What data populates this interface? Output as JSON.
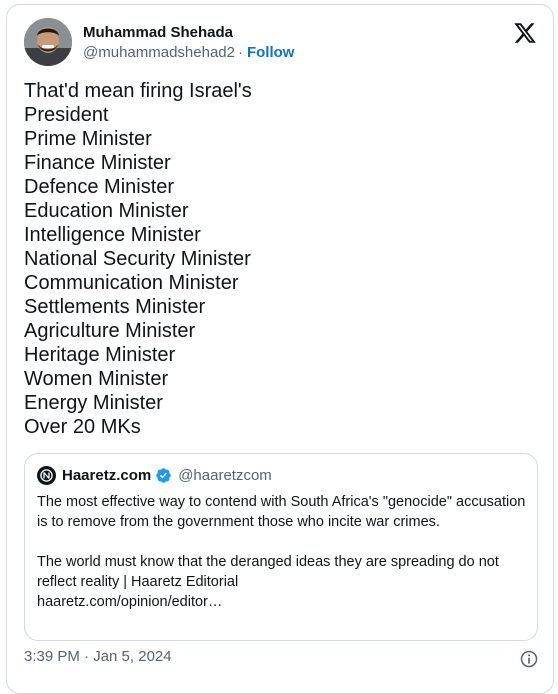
{
  "author": {
    "name": "Muhammad Shehada",
    "handle": "@muhammadshehad2",
    "separator": "·",
    "follow_label": "Follow"
  },
  "tweet": {
    "lines": [
      "That'd mean firing Israel's",
      "President",
      "Prime Minister",
      "Finance Minister",
      "Defence Minister",
      "Education Minister",
      "Intelligence Minister",
      "National Security Minister",
      "Communication Minister",
      "Settlements Minister",
      "Agriculture Minister",
      "Heritage Minister",
      "Women Minister",
      "Energy Minister",
      "Over 20 MKs"
    ]
  },
  "quote": {
    "name": "Haaretz.com",
    "handle": "@haaretzcom",
    "paragraph1": "The most effective way to contend with South Africa's \"genocide\" accusation is to remove from the government those who incite war crimes.",
    "paragraph2": "The world must know that the deranged ideas they are spreading do not reflect reality | Haaretz Editorial",
    "link": "haaretz.com/opinion/editor…"
  },
  "footer": {
    "timestamp": "3:39 PM · Jan 5, 2024"
  },
  "icons": {
    "platform": "x-logo-icon",
    "verified": "verified-badge-icon",
    "info": "info-icon"
  },
  "colors": {
    "link": "#0f73c7",
    "verified": "#1d9bf0",
    "muted": "#536471",
    "border": "#cfd9de"
  }
}
